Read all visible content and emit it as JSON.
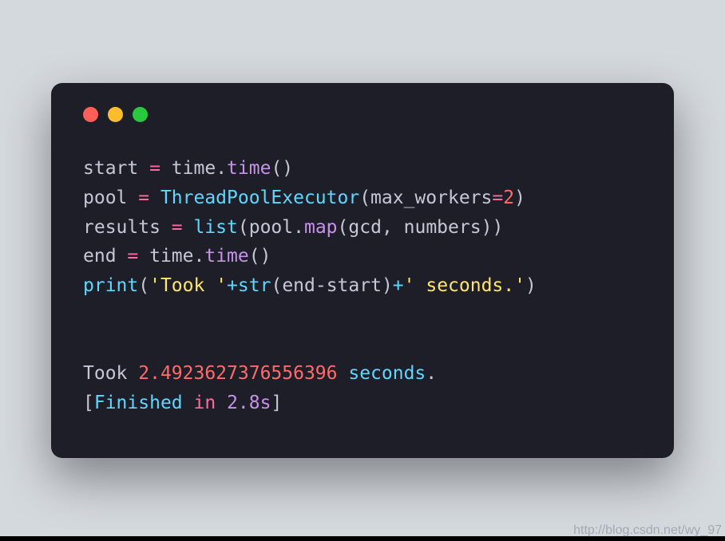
{
  "code": {
    "line1": {
      "var1": "start",
      "eq": " = ",
      "obj": "time",
      "dot": ".",
      "method": "time",
      "parens": "()"
    },
    "line2": {
      "var1": "pool",
      "eq": " = ",
      "cls": "ThreadPoolExecutor",
      "open": "(",
      "kwarg": "max_workers",
      "assign": "=",
      "num": "2",
      "close": ")"
    },
    "line3": {
      "var1": "results",
      "eq": " = ",
      "list": "list",
      "open1": "(",
      "obj": "pool",
      "dot": ".",
      "map": "map",
      "open2": "(",
      "arg1": "gcd",
      "comma": ", ",
      "arg2": "numbers",
      "close2": ")",
      "close1": ")"
    },
    "line4": {
      "var1": "end",
      "eq": " = ",
      "obj": "time",
      "dot": ".",
      "method": "time",
      "parens": "()"
    },
    "line5": {
      "print": "print",
      "open": "(",
      "str1": "'Took '",
      "plus1": "+",
      "str": "str",
      "open2": "(",
      "expr": "end-start",
      "close2": ")",
      "plus2": "+",
      "str2": "' seconds.'",
      "close": ")"
    }
  },
  "output": {
    "line1": {
      "took": "Took ",
      "num": "2.4923627376556396",
      "seconds": " seconds",
      "dot": "."
    },
    "line2": {
      "open": "[",
      "finished": "Finished",
      "sp1": " ",
      "in": "in",
      "sp2": " ",
      "time": "2.8s",
      "close": "]"
    }
  },
  "watermark": "http://blog.csdn.net/wy_97"
}
